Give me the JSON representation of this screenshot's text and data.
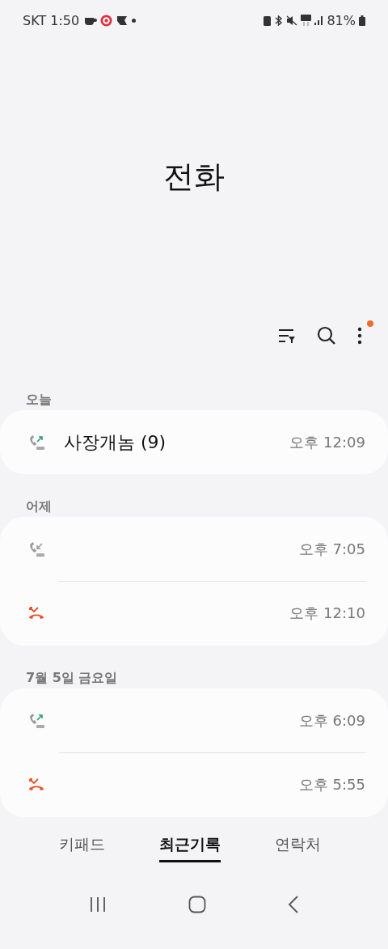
{
  "status_bar": {
    "carrier_time": "SKT 1:50",
    "battery": "81%"
  },
  "title": "전화",
  "toolbar": {
    "menu_badge": true
  },
  "sections": [
    {
      "header": "오늘",
      "calls": [
        {
          "kind": "outgoing",
          "name": "사장개놈 (9)",
          "time": "오후 12:09"
        }
      ]
    },
    {
      "header": "어제",
      "calls": [
        {
          "kind": "incoming",
          "time": "오후 7:05"
        },
        {
          "kind": "missed",
          "time": "오후 12:10"
        }
      ]
    },
    {
      "header": "7월 5일 금요일",
      "calls": [
        {
          "kind": "outgoing",
          "time": "오후 6:09"
        },
        {
          "kind": "missed",
          "time": "오후 5:55"
        }
      ]
    }
  ],
  "tabs": [
    {
      "label": "키패드",
      "selected": false
    },
    {
      "label": "최근기록",
      "selected": true
    },
    {
      "label": "연락처",
      "selected": false
    }
  ]
}
